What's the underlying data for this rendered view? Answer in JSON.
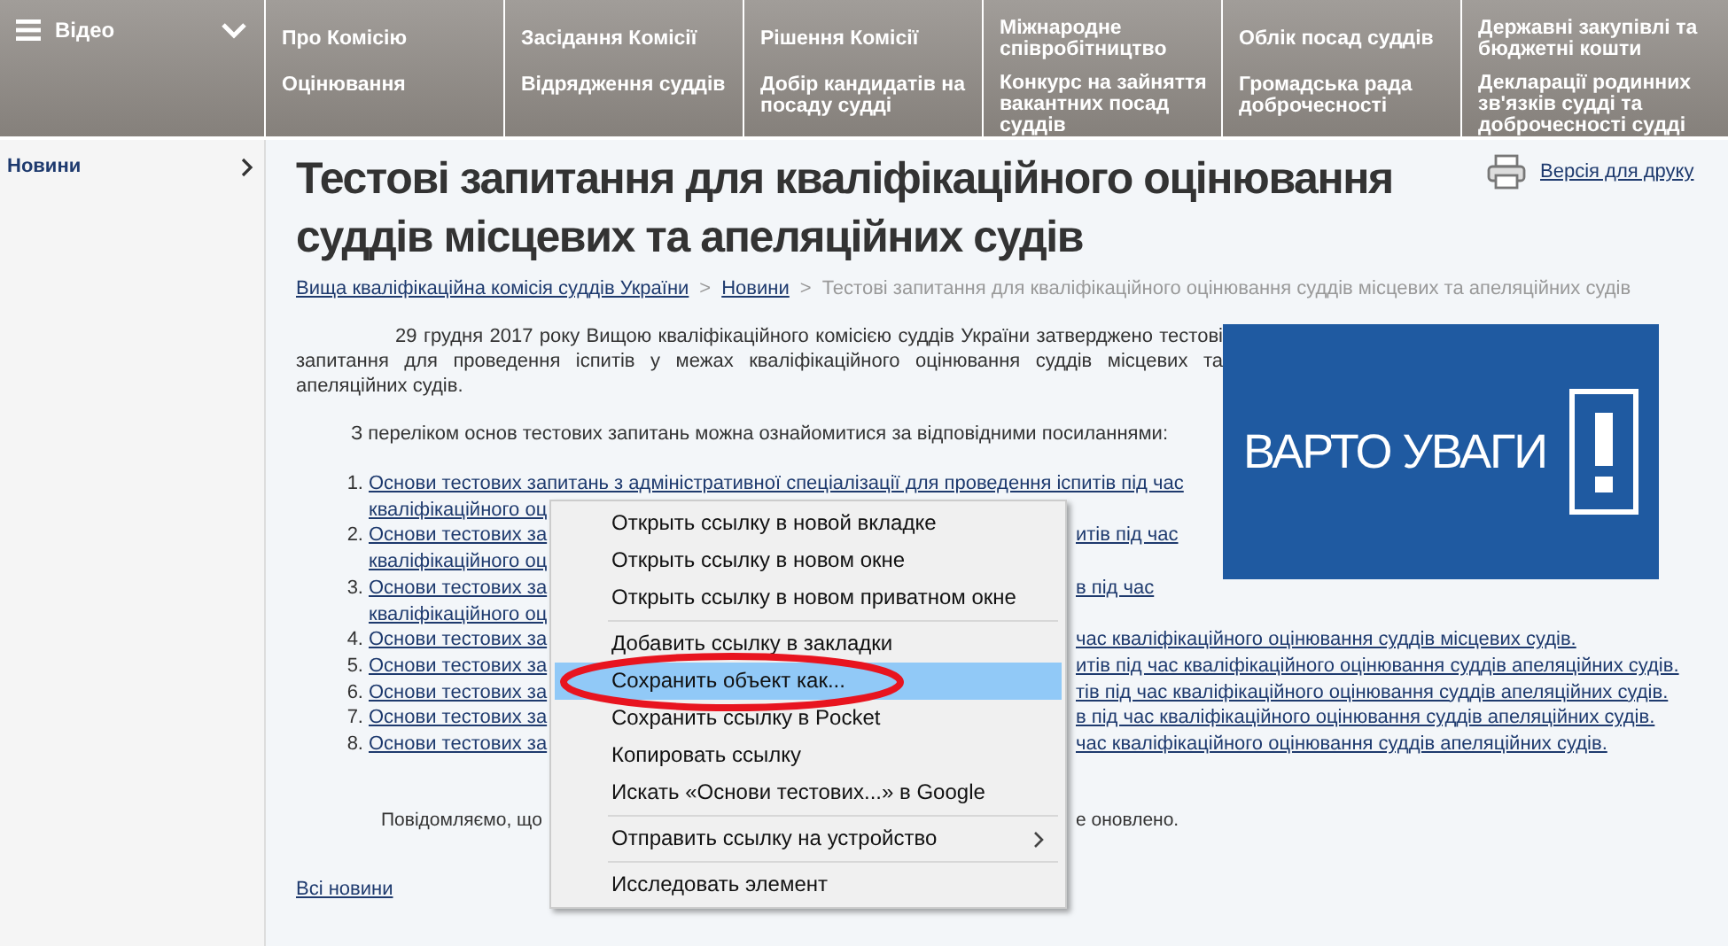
{
  "sidebar": {
    "header": "Відео",
    "items": [
      {
        "label": "Новини"
      }
    ]
  },
  "nav": {
    "columns": [
      [
        "Про Комісію",
        "Оцінювання"
      ],
      [
        "Засідання Комісії",
        "Відрядження суддів"
      ],
      [
        "Рішення Комісії",
        "Добір кандидатів на посаду судді"
      ],
      [
        "Міжнародне співробітництво",
        "Конкурс на зайняття вакантних посад суддів"
      ],
      [
        "Облік посад суддів",
        "Громадська рада доброчесності"
      ],
      [
        "Державні закупівлі та бюджетні кошти",
        "Декларації родинних зв'язків судді та доброчесності судді"
      ]
    ]
  },
  "article": {
    "title": "Тестові запитання для кваліфікаційного оцінювання суддів місцевих та апеляційних судів",
    "print_link": "Версія для друку",
    "breadcrumbs": [
      {
        "kind": "link",
        "label": "Вища кваліфікаційна комісія суддів України"
      },
      {
        "kind": "separator",
        "label": ">"
      },
      {
        "kind": "link",
        "label": "Новини"
      },
      {
        "kind": "separator",
        "label": ">"
      },
      {
        "kind": "current",
        "label": "Тестові запитання для кваліфікаційного оцінювання суддів місцевих та апеляційних судів"
      }
    ],
    "paragraphs": [
      "29 грудня 2017 року Вищою кваліфікаційного комісією суддів України затверджено тестові запитання для проведення іспитів у межах кваліфікаційного оцінювання суддів місцевих та апеляційних судів.",
      "З переліком основ тестових запитань можна ознайомитися за відповідними посиланнями:"
    ],
    "banner": "ВАРТО УВАГИ",
    "links": [
      {
        "number": "1.",
        "lines": [
          {
            "left": "Основи тестових запитань з адміністративної спеціалізації для проведення іспитів під час"
          },
          {
            "left": "кваліфікаційного оц"
          }
        ]
      },
      {
        "number": "2.",
        "lines": [
          {
            "left": "Основи тестових за",
            "right": "итів під час"
          },
          {
            "left": "кваліфікаційного оц"
          }
        ]
      },
      {
        "number": "3.",
        "lines": [
          {
            "left": "Основи тестових за",
            "right": "в під час"
          },
          {
            "left": "кваліфікаційного оц"
          }
        ]
      },
      {
        "number": "4.",
        "lines": [
          {
            "left": "Основи тестових за",
            "right": "час кваліфікаційного оцінювання суддів місцевих судів."
          }
        ]
      },
      {
        "number": "5.",
        "lines": [
          {
            "left": "Основи тестових за",
            "right": "итів під час кваліфікаційного оцінювання суддів апеляційних судів."
          }
        ]
      },
      {
        "number": "6.",
        "lines": [
          {
            "left": "Основи тестових за",
            "right": "тів під час кваліфікаційного оцінювання суддів апеляційних судів."
          }
        ]
      },
      {
        "number": "7.",
        "lines": [
          {
            "left": "Основи тестових за",
            "right": "в під час кваліфікаційного оцінювання суддів апеляційних судів."
          }
        ]
      },
      {
        "number": "8.",
        "lines": [
          {
            "left": "Основи тестових за",
            "right": "час кваліфікаційного оцінювання суддів апеляційних судів."
          }
        ]
      }
    ],
    "notice": {
      "left": "Повідомляємо, що",
      "right": "е оновлено."
    },
    "all_news": "Всі новини"
  },
  "context_menu": {
    "items": [
      {
        "kind": "item",
        "label": "Открыть ссылку в новой вкладке",
        "selected": false
      },
      {
        "kind": "item",
        "label": "Открыть ссылку в новом окне",
        "selected": false
      },
      {
        "kind": "item",
        "label": "Открыть ссылку в новом приватном окне",
        "selected": false
      },
      {
        "kind": "separator"
      },
      {
        "kind": "item",
        "label": "Добавить ссылку в закладки",
        "selected": false
      },
      {
        "kind": "item",
        "label": "Сохранить объект как...",
        "selected": true
      },
      {
        "kind": "item",
        "label": "Сохранить ссылку в Pocket",
        "selected": false
      },
      {
        "kind": "item",
        "label": "Копировать ссылку",
        "selected": false
      },
      {
        "kind": "item",
        "label": "Искать «Основи тестових...» в Google",
        "selected": false
      },
      {
        "kind": "separator"
      },
      {
        "kind": "submenu",
        "label": "Отправить ссылку на устройство",
        "selected": false
      },
      {
        "kind": "separator"
      },
      {
        "kind": "item",
        "label": "Исследовать элемент",
        "selected": false
      }
    ]
  }
}
